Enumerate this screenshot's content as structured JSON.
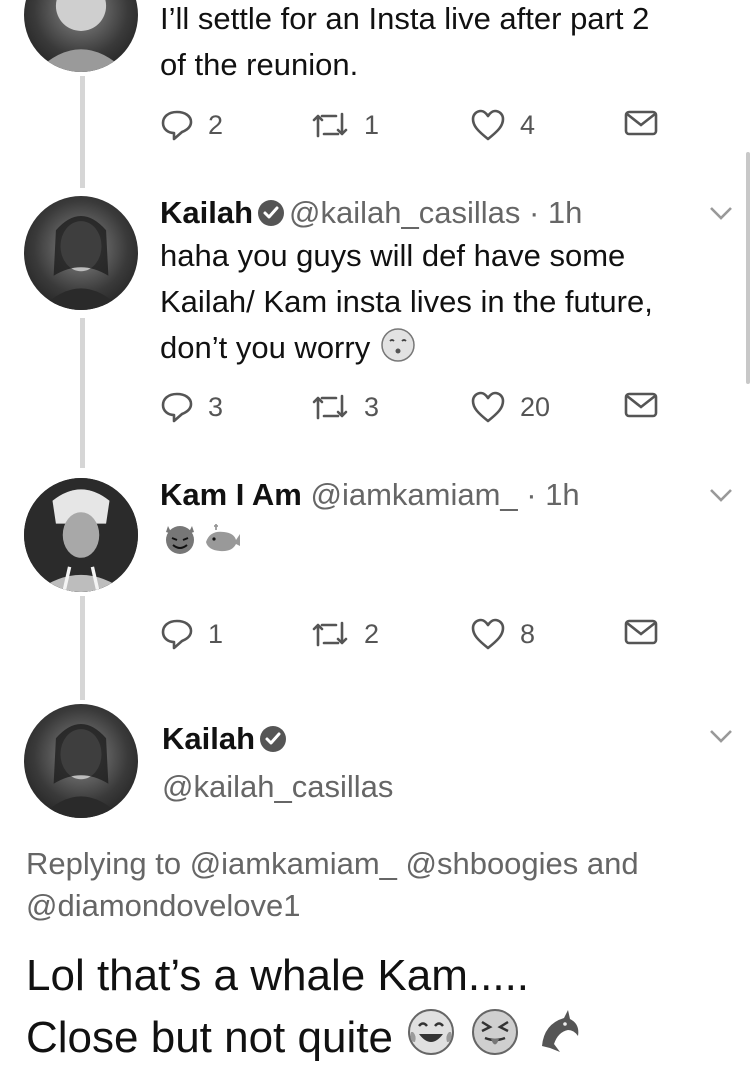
{
  "colors": {
    "text": "#111111",
    "secondary": "#666666",
    "thread": "#d6d6d6"
  },
  "tweet0": {
    "text_line1": "I’ll settle for an Insta live after part 2",
    "text_line2": "of the reunion.",
    "replies": "2",
    "retweets": "1",
    "likes": "4"
  },
  "tweet1": {
    "name": "Kailah",
    "handle_time": "@kailah_casillas · 1h",
    "line1": "haha you guys will def have some",
    "line2": "Kailah/ Kam insta lives in the future,",
    "line3": "don’t you worry",
    "replies": "3",
    "retweets": "3",
    "likes": "20"
  },
  "tweet2": {
    "name": "Kam I Am",
    "handle_time": "@iamkamiam_ · 1h",
    "replies": "1",
    "retweets": "2",
    "likes": "8"
  },
  "main_tweet": {
    "name": "Kailah",
    "handle": "@kailah_casillas",
    "replying_line1": "Replying to @iamkamiam_ @shboogies and",
    "replying_line2": "@diamondovelove1",
    "text_line1": "Lol that’s a whale Kam.....",
    "text_line2": "Close but not quite"
  },
  "icons": [
    "reply-icon",
    "retweet-icon",
    "like-icon",
    "direct-message-icon",
    "verified-icon",
    "chevron-down-icon"
  ]
}
